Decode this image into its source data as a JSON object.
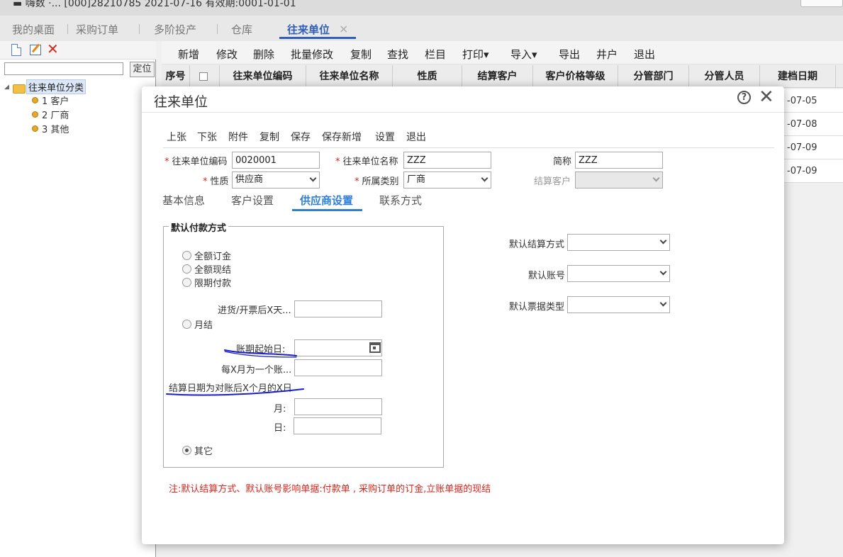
{
  "topbar": {
    "text": "▬ 嗨数 ·...  [000]28210785      2021-07-16   有效期:0001-01-01"
  },
  "tabs": [
    {
      "label": "我的桌面"
    },
    {
      "label": "采购订单"
    },
    {
      "label": "多阶投产"
    },
    {
      "label": "仓库"
    },
    {
      "label": "往来单位"
    }
  ],
  "tab_close": "×",
  "left_panel": {
    "locate_button": "定位",
    "tree_root": "往来单位分类",
    "tree_items": [
      "1 客户",
      "2 厂商",
      "3 其他"
    ]
  },
  "main_toolbar": [
    "新增",
    "修改",
    "删除",
    "批量修改",
    "复制",
    "查找",
    "栏目",
    "打印▾",
    "导入▾",
    "导出",
    "井户",
    "退出"
  ],
  "grid": {
    "columns": [
      "序号",
      "",
      "往来单位编码",
      "往来单位名称",
      "性质",
      "结算客户",
      "客户价格等级",
      "分管部门",
      "分管人员",
      "建档日期"
    ],
    "dates": [
      "-07-05",
      "-07-08",
      "-07-09",
      "-07-09"
    ]
  },
  "modal": {
    "title": "往来单位",
    "help": "?",
    "close": "✕",
    "toolbar": [
      "上张",
      "下张",
      "附件",
      "复制",
      "保存",
      "保存新增",
      "设置",
      "退出"
    ],
    "fields": {
      "code_label": "往来单位编码",
      "code_value": "0020001",
      "name_label": "往来单位名称",
      "name_value": "ZZZ",
      "short_label": "简称",
      "short_value": "ZZZ",
      "nature_label": "性质",
      "nature_value": "供应商",
      "category_label": "所属类别",
      "category_value": "厂商",
      "settle_label": "结算客户",
      "settle_value": ""
    },
    "subtabs": [
      "基本信息",
      "客户设置",
      "供应商设置",
      "联系方式"
    ],
    "payment": {
      "legend": "默认付款方式",
      "options": [
        "全额订金",
        "全额现结",
        "限期付款",
        "月结",
        "其它"
      ],
      "days_label": "进货/开票后X天...",
      "start_label": "账期起始日:",
      "period_label": "每X月为一个账...",
      "settle_date_label": "结算日期为对账后X个月的X日",
      "month_label": "月:",
      "day_label": "日:"
    },
    "defaults": {
      "method_label": "默认结算方式",
      "account_label": "默认账号",
      "bill_label": "默认票据类型"
    },
    "note": "注:默认结算方式、默认账号影响单据:付款单 , 采购订单的订金,立账单据的现结"
  },
  "colors": {
    "accent": "#2f5fb6",
    "subtab_accent": "#2f7fd8",
    "required": "#d9261c",
    "annotation": "#1a1fc8"
  }
}
